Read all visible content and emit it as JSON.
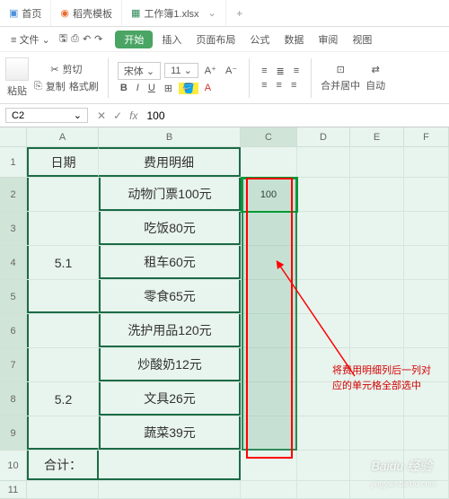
{
  "tabs": [
    {
      "label": "首页"
    },
    {
      "label": "稻壳模板"
    },
    {
      "label": "工作簿1.xlsx",
      "active": true
    }
  ],
  "menubar": {
    "file": "文件",
    "start": "开始",
    "insert": "插入",
    "page_layout": "页面布局",
    "formula": "公式",
    "data": "数据",
    "review": "审阅",
    "view": "视图"
  },
  "toolbar": {
    "paste": "粘贴",
    "cut": "剪切",
    "copy": "复制",
    "format_painter": "格式刷",
    "font_name": "宋体",
    "font_size": "11",
    "merge": "合并居中",
    "auto": "自动"
  },
  "ref": {
    "cell": "C2",
    "formula": "100"
  },
  "columns": [
    "A",
    "B",
    "C",
    "D",
    "E",
    "F"
  ],
  "rows": [
    "1",
    "2",
    "3",
    "4",
    "5",
    "6",
    "7",
    "8",
    "9",
    "10",
    "11"
  ],
  "table": {
    "header_date": "日期",
    "header_detail": "费用明细",
    "group1_label": "5.1",
    "group2_label": "5.2",
    "total_label": "合计：",
    "c2_value": "100",
    "items": [
      "动物门票100元",
      "吃饭80元",
      "租车60元",
      "零食65元",
      "洗护用品120元",
      "炒酸奶12元",
      "文具26元",
      "蔬菜39元"
    ]
  },
  "annotation": "将费用明细列后一列对\n应的单元格全部选中",
  "watermark": {
    "main": "Baidu 经验",
    "sub": "jingyan.baidu.com"
  }
}
